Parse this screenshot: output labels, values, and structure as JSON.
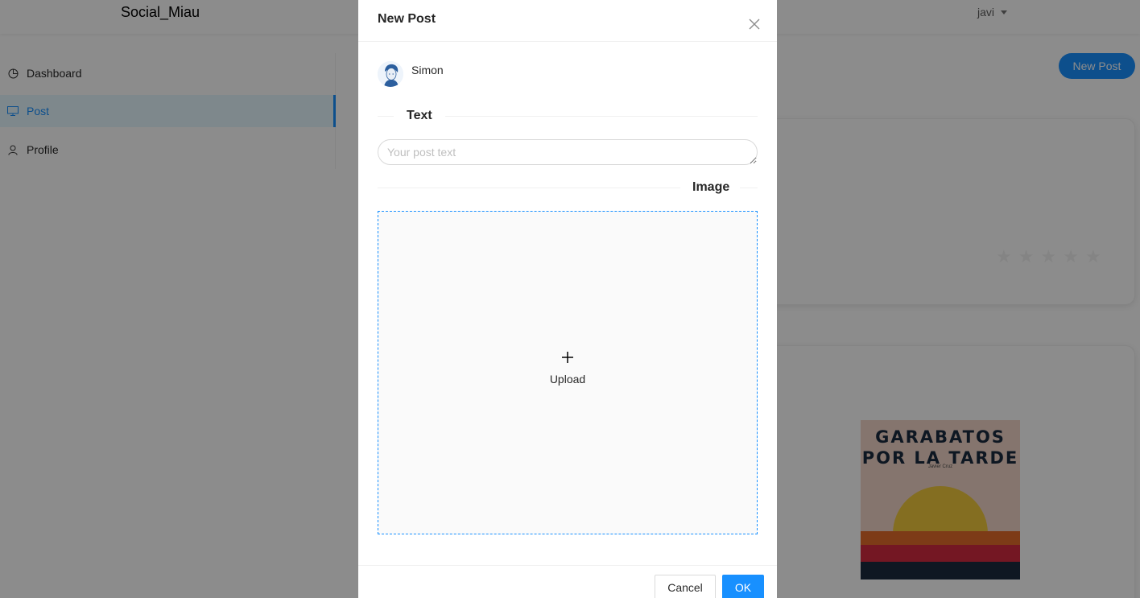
{
  "app": {
    "brand": "Social_Miau",
    "user": "javi"
  },
  "sidebar": {
    "items": [
      {
        "label": "Dashboard",
        "icon": "pie-chart-icon"
      },
      {
        "label": "Post",
        "icon": "desktop-icon",
        "active": true
      },
      {
        "label": "Profile",
        "icon": "user-icon"
      }
    ]
  },
  "page": {
    "new_post_label": "New Post",
    "rating": {
      "filled": 0,
      "max": 5
    },
    "book_cover": {
      "title_line1": "GARABATOS",
      "title_line2": "POR LA TARDE",
      "author": "Javier Cruz"
    }
  },
  "modal": {
    "title": "New Post",
    "author_name": "Simon",
    "text_section_label": "Text",
    "text_placeholder": "Your post text",
    "text_value": "",
    "image_section_label": "Image",
    "upload_label": "Upload",
    "cancel_label": "Cancel",
    "ok_label": "OK"
  },
  "colors": {
    "primary": "#1890ff",
    "mask": "rgba(0,0,0,0.45)",
    "border": "#d9d9d9"
  }
}
